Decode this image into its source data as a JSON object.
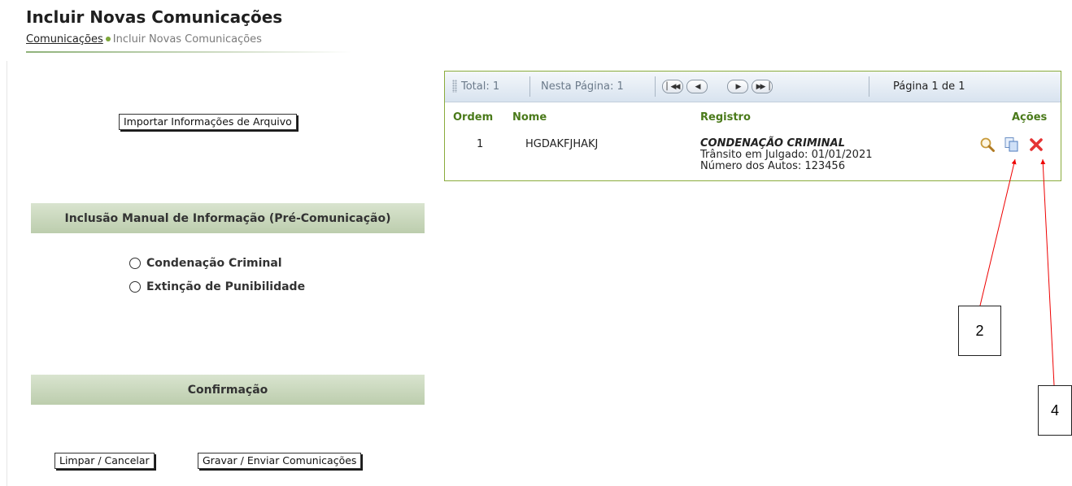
{
  "page": {
    "title": "Incluir Novas Comunicações",
    "breadcrumb": {
      "parent": "Comunicações",
      "current": "Incluir Novas Comunicações"
    }
  },
  "left_panel": {
    "import_button": "Importar Informações de Arquivo",
    "manual_section": {
      "title": "Inclusão Manual de Informação (Pré-Comunicação)",
      "options": [
        {
          "label": "Condenação Criminal",
          "selected": false
        },
        {
          "label": "Extinção de Punibilidade",
          "selected": false
        }
      ]
    },
    "confirm_section": {
      "title": "Confirmação"
    },
    "buttons": {
      "clear": "Limpar / Cancelar",
      "save": "Gravar / Enviar Comunicações"
    }
  },
  "grid": {
    "toolbar": {
      "total": "Total: 1",
      "on_page": "Nesta Página: 1",
      "page_info": "Página 1 de 1",
      "nav_icons": [
        "first-page-icon",
        "prev-page-icon",
        "next-page-icon",
        "last-page-icon"
      ]
    },
    "headers": {
      "ordem": "Ordem",
      "nome": "Nome",
      "registro": "Registro",
      "acoes": "Ações"
    },
    "rows": [
      {
        "ordem": "1",
        "nome": "HGDAKFJHAKJ",
        "registro_title": "CONDENAÇÃO CRIMINAL",
        "registro_line1": "Trânsito em Julgado: 01/01/2021",
        "registro_line2": "Número dos Autos: 123456",
        "actions": [
          "magnifier-icon",
          "copy-icon",
          "delete-icon"
        ]
      }
    ]
  },
  "annotations": {
    "callout_a": "2",
    "callout_b": "4",
    "arrow_color": "#ee0000"
  },
  "colors": {
    "section_bar": "#c7d6b9",
    "grid_border": "#8aab3c",
    "header_text": "#4a7a1a",
    "accent_dot": "#7da63a",
    "delete": "#e53333"
  }
}
